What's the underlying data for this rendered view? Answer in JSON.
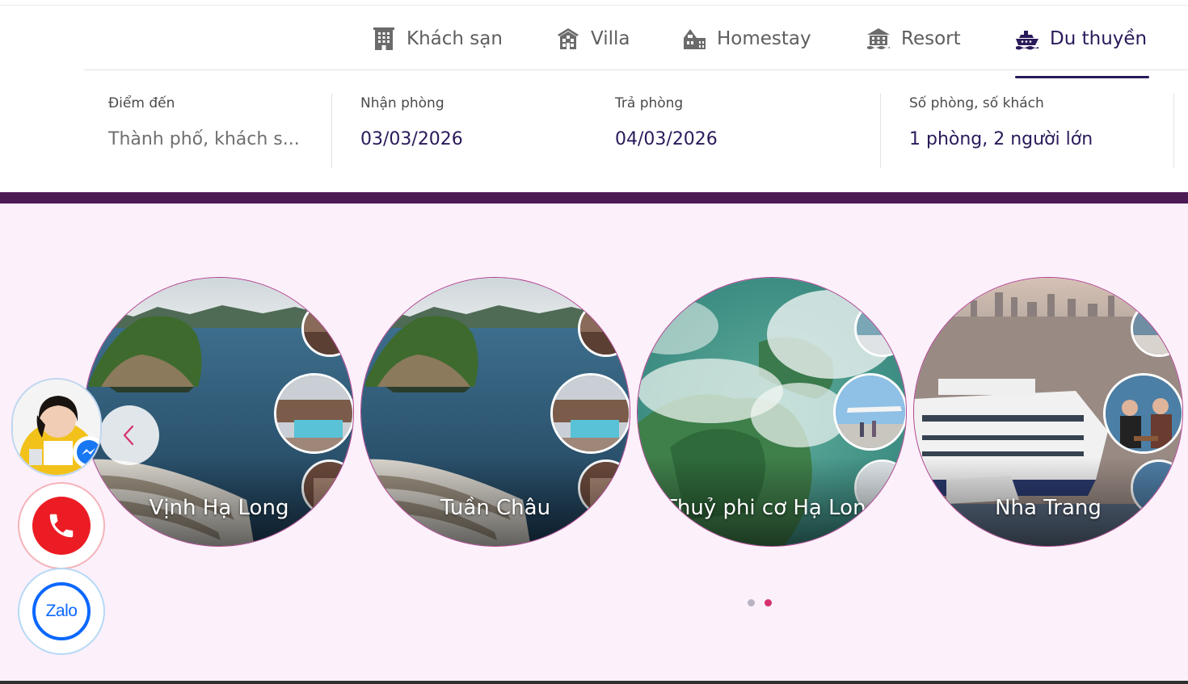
{
  "tabs": [
    {
      "label": "Khách sạn",
      "icon": "building-icon",
      "active": false
    },
    {
      "label": "Villa",
      "icon": "villa-icon",
      "active": false
    },
    {
      "label": "Homestay",
      "icon": "homestay-icon",
      "active": false
    },
    {
      "label": "Resort",
      "icon": "resort-icon",
      "active": false
    },
    {
      "label": "Du thuyền",
      "icon": "cruise-ship-icon",
      "active": true
    }
  ],
  "search": {
    "destination": {
      "label": "Điểm đến",
      "placeholder": "Thành phố, khách s..."
    },
    "checkin": {
      "label": "Nhận phòng",
      "value": "03/03/2026"
    },
    "checkout": {
      "label": "Trả phòng",
      "value": "04/03/2026"
    },
    "guests": {
      "label": "Số phòng, số khách",
      "value": "1 phòng, 2 người lớn"
    }
  },
  "destinations": [
    {
      "name": "Vịnh Hạ Long"
    },
    {
      "name": "Tuần Châu"
    },
    {
      "name": "Thuỷ phi cơ Hạ Long"
    },
    {
      "name": "Nha Trang"
    }
  ],
  "carousel": {
    "prev_icon": "chevron-left-icon",
    "pages": 2,
    "active_page": 2
  },
  "contact": {
    "messenger_icon": "messenger-icon",
    "phone_icon": "phone-icon",
    "zalo_label": "Zalo"
  },
  "colors": {
    "brand_dark": "#2b1a5a",
    "band": "#4e1a56",
    "section_bg": "#fcf0fb",
    "dot_active": "#d6306f",
    "phone_red": "#ec1c24",
    "zalo_blue": "#0b68ff"
  }
}
